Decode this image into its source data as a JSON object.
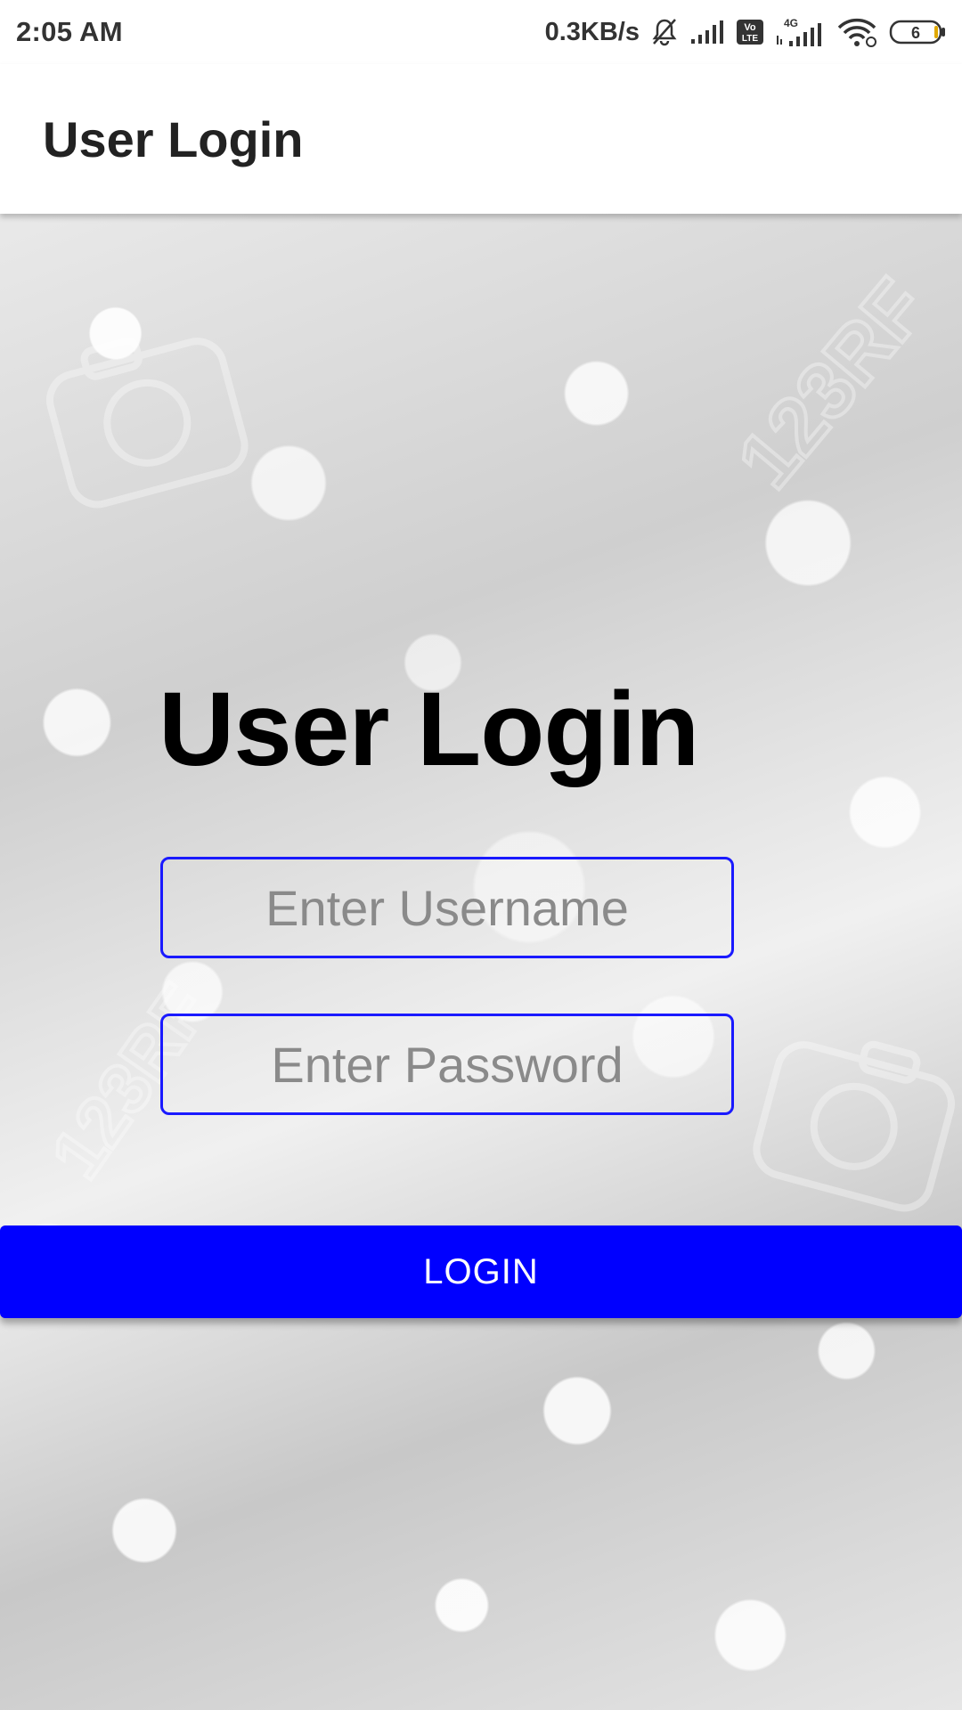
{
  "status_bar": {
    "time": "2:05 AM",
    "network_speed": "0.3KB/s",
    "volte_label_top": "Vo",
    "volte_label_bottom": "LTE",
    "network_type": "4G",
    "battery_level": "6"
  },
  "app_bar": {
    "title": "User Login"
  },
  "login_form": {
    "heading": "User Login",
    "username_placeholder": "Enter Username",
    "password_placeholder": "Enter Password",
    "login_button_label": "LOGIN"
  },
  "watermark": {
    "text": "123RF"
  },
  "colors": {
    "accent": "#0000ff",
    "field_border": "#1a1aff",
    "placeholder_text": "#8a8a8a"
  }
}
